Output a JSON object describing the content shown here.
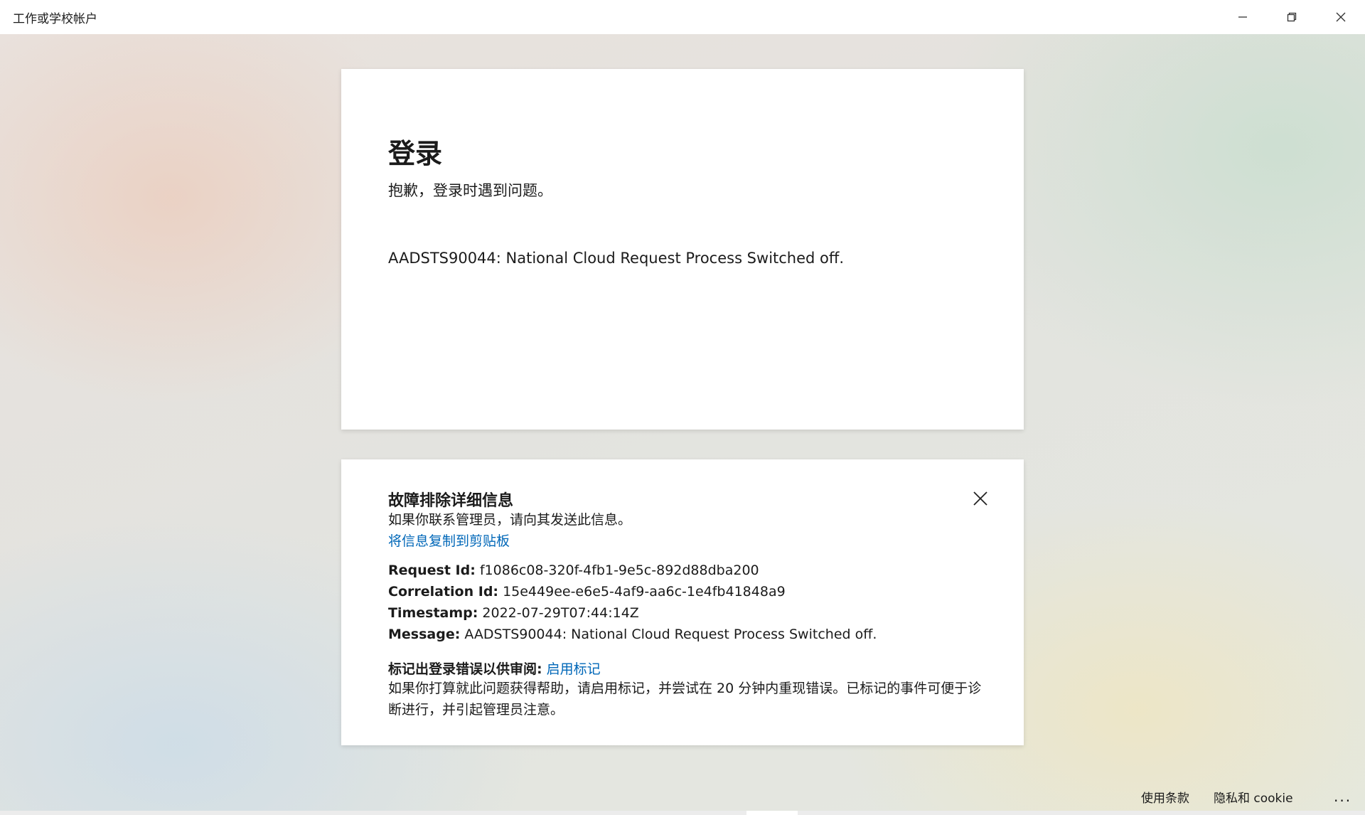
{
  "window": {
    "title": "工作或学校帐户",
    "controls": [
      "minimize-icon",
      "restore-icon",
      "close-icon"
    ]
  },
  "signin": {
    "heading": "登录",
    "subtitle": "抱歉，登录时遇到问题。",
    "error": "AADSTS90044: National Cloud Request Process Switched off."
  },
  "troubleshooting": {
    "title": "故障排除详细信息",
    "subtitle": "如果你联系管理员，请向其发送此信息。",
    "copy_link": "将信息复制到剪贴板",
    "request_id_label": "Request Id:",
    "request_id": "f1086c08-320f-4fb1-9e5c-892d88dba200",
    "correlation_id_label": "Correlation Id:",
    "correlation_id": "15e449ee-e6e5-4af9-aa6c-1e4fb41848a9",
    "timestamp_label": "Timestamp:",
    "timestamp": "2022-07-29T07:44:14Z",
    "message_label": "Message:",
    "message": "AADSTS90044: National Cloud Request Process Switched off.",
    "flag_label": "标记出登录错误以供审阅:",
    "flag_link": "启用标记",
    "flag_description": "如果你打算就此问题获得帮助，请启用标记，并尝试在 20 分钟内重现错误。已标记的事件可便于诊断进行，并引起管理员注意。"
  },
  "footer": {
    "terms": "使用条款",
    "privacy": "隐私和 cookie",
    "more": "..."
  },
  "colors": {
    "link": "#0067b8",
    "card": "#ffffff",
    "text": "#1b1b1b"
  }
}
